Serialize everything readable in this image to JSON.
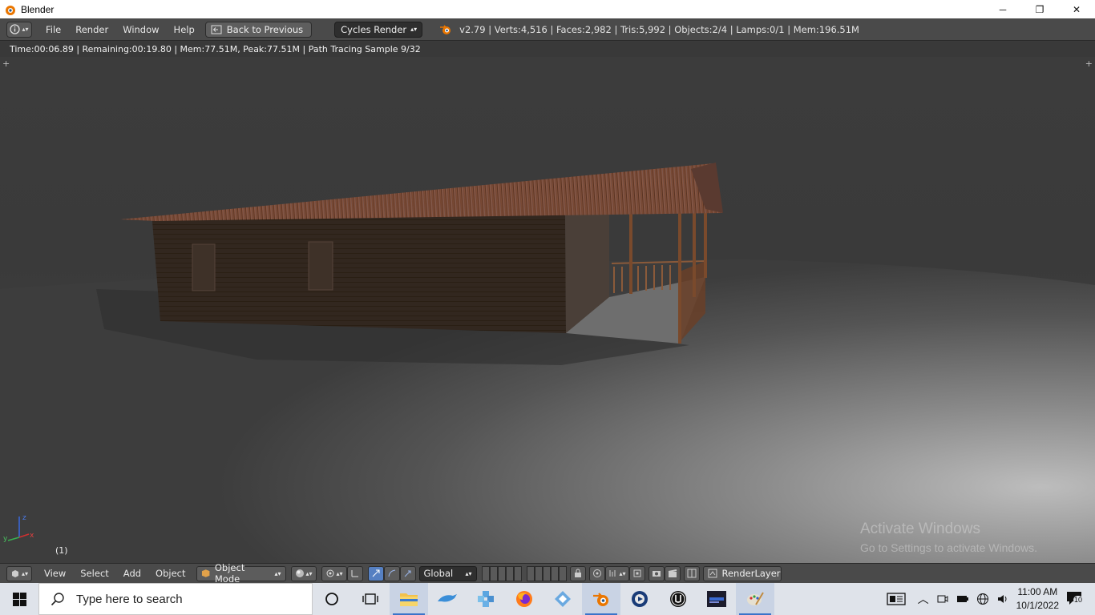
{
  "window": {
    "title": "Blender",
    "minimize": "─",
    "restore": "❐",
    "close": "✕"
  },
  "info_header": {
    "menus": [
      "File",
      "Render",
      "Window",
      "Help"
    ],
    "back_button": "Back to Previous",
    "render_engine": "Cycles Render",
    "stats": "v2.79 | Verts:4,516 | Faces:2,982 | Tris:5,992 | Objects:2/4 | Lamps:0/1 | Mem:196.51M"
  },
  "render_status": "Time:00:06.89 | Remaining:00:19.80 | Mem:77.51M, Peak:77.51M | Path Tracing Sample 9/32",
  "viewport": {
    "frame_label": "(1)",
    "axis": {
      "x": "x",
      "y": "y",
      "z": "z"
    },
    "watermark_line1": "Activate Windows",
    "watermark_line2": "Go to Settings to activate Windows."
  },
  "view_header": {
    "menus": [
      "View",
      "Select",
      "Add",
      "Object"
    ],
    "mode": "Object Mode",
    "orientation": "Global",
    "render_layer": "RenderLayer"
  },
  "taskbar": {
    "search_placeholder": "Type here to search",
    "time": "11:00 AM",
    "date": "10/1/2022",
    "notification_count": "10",
    "apps": [
      "cortana-icon",
      "task-view-icon",
      "file-explorer-icon",
      "dolphin-icon",
      "puzzle-icon",
      "firefox-icon",
      "app-diamond-icon",
      "blender-icon",
      "media-player-icon",
      "unreal-engine-icon",
      "dark-app-icon",
      "paint-icon"
    ]
  },
  "colors": {
    "blender_header": "#4a4a4a",
    "viewport_bg": "#3b3b3b",
    "taskbar": "#dfe3ea",
    "rust_roof": "#8a4a2a"
  }
}
